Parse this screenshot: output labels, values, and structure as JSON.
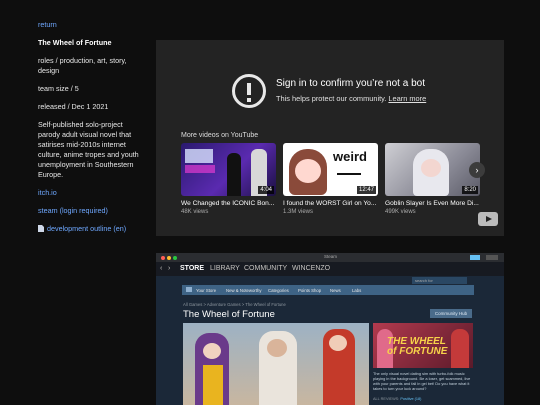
{
  "sidebar": {
    "return": "return",
    "title": "The Wheel of Fortune",
    "roles": "roles / production, art, story, design",
    "team": "team size / 5",
    "released": "released / Dec 1 2021",
    "desc": "Self-published solo-project parody adult visual novel that satirises mid-2010s internet culture, anime tropes and youth unemployment in Southestern Europe.",
    "itch": "itch.io",
    "steam": "steam (login required)",
    "outline": "development outline (en)"
  },
  "youtube": {
    "heading": "Sign in to confirm you’re not a bot",
    "sub": "This helps protect our community.",
    "learn": "Learn more",
    "more": "More videos on YouTube",
    "videos": [
      {
        "title": "We Changed the ICONIC Bon...",
        "views": "48K views",
        "duration": "4:04"
      },
      {
        "title": "I found the WORST Girl on Yo...",
        "views": "1.3M views",
        "duration": "12:47"
      },
      {
        "title": "Goblin Slayer Is Even More Di...",
        "views": "499K views",
        "duration": "8:20"
      }
    ],
    "thumb_text": "weird"
  },
  "steam": {
    "window_title": "Steam",
    "nav": [
      "STORE",
      "LIBRARY",
      "COMMUNITY",
      "WINCENZO"
    ],
    "subnav": [
      "Your Store",
      "New & Noteworthy",
      "Categories",
      "Points Shop",
      "News",
      "Labs"
    ],
    "search": "search for",
    "crumb": "All Games > Adventure Games > The Wheel of Fortune",
    "title": "The Wheel of Fortune",
    "hub": "Community Hub",
    "cap_title_1": "THE WHEEL",
    "cap_title_2": "of FORTUNE",
    "desc": "The only visual novel dating sim with turbo-folk music playing in the background. Be a loser, get scammed, live with your parents and fall in gel bet! Do you have what it takes to turn your luck around?",
    "review_label": "ALL REVIEWS:",
    "review_value": "Positive (18)"
  }
}
